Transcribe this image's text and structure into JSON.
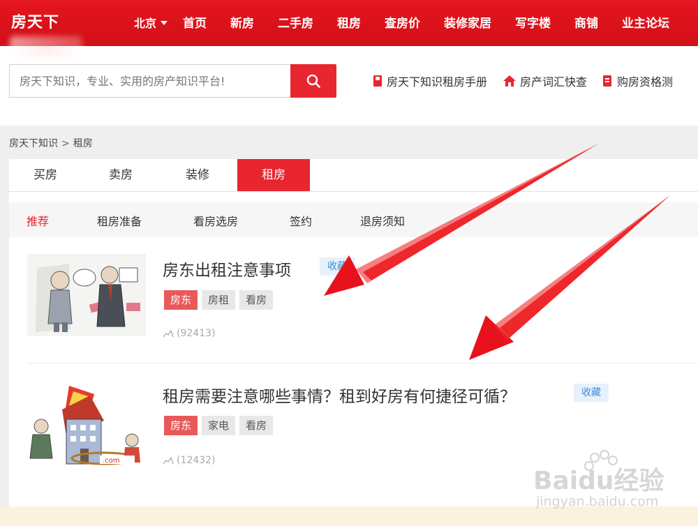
{
  "header": {
    "logo_text": "房天下",
    "city": "北京",
    "nav": [
      "首页",
      "新房",
      "二手房",
      "租房",
      "查房价",
      "装修家居",
      "写字楼",
      "商铺",
      "业主论坛"
    ]
  },
  "search": {
    "placeholder": "房天下知识，专业、实用的房产知识平台!",
    "quick_links": [
      "房天下知识租房手册",
      "房产词汇快查",
      "购房资格测"
    ]
  },
  "breadcrumb": {
    "items": [
      "房天下知识",
      "租房"
    ],
    "separator": ">"
  },
  "tabs": [
    "买房",
    "卖房",
    "装修",
    "租房"
  ],
  "active_tab": "租房",
  "subtabs": [
    "推荐",
    "租房准备",
    "看房选房",
    "签约",
    "退房须知"
  ],
  "articles": [
    {
      "title": "房东出租注意事项",
      "fav_label": "收藏",
      "tags": [
        "房东",
        "房租",
        "看房"
      ],
      "views": "(92413)"
    },
    {
      "title": "租房需要注意哪些事情？租到好房有何捷径可循？",
      "fav_label": "收藏",
      "tags": [
        "房东",
        "家电",
        "看房"
      ],
      "views": "(12432)"
    }
  ],
  "watermark": {
    "brand": "Baidu经验",
    "url": "jingyan.baidu.com"
  },
  "colors": {
    "brand_red": "#e9252f",
    "tag_hot": "#e85a5a",
    "fav_blue": "#3a8fd8",
    "arrow_red": "#e8121c"
  }
}
